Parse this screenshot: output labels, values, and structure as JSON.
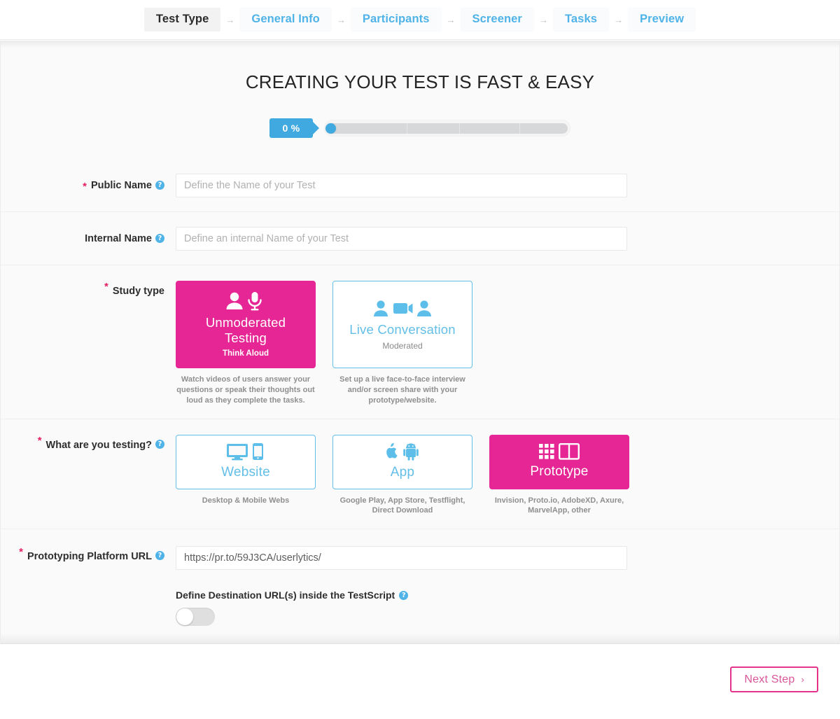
{
  "stepnav": {
    "separator": "→",
    "steps": [
      {
        "label": "Test Type",
        "state": "active"
      },
      {
        "label": "General Info",
        "state": "link"
      },
      {
        "label": "Participants",
        "state": "link"
      },
      {
        "label": "Screener",
        "state": "link"
      },
      {
        "label": "Tasks",
        "state": "link"
      },
      {
        "label": "Preview",
        "state": "link"
      }
    ]
  },
  "page": {
    "title": "CREATING YOUR TEST IS FAST & EASY"
  },
  "progress": {
    "percent_label": "0 %",
    "value": 0
  },
  "help_glyph": "?",
  "required_glyph": "*",
  "form": {
    "public_name": {
      "label": "Public Name",
      "required": true,
      "placeholder": "Define the Name of your Test",
      "value": ""
    },
    "internal_name": {
      "label": "Internal Name",
      "required": false,
      "placeholder": "Define an internal Name of your Test",
      "value": ""
    },
    "study_type": {
      "label": "Study type",
      "required": true,
      "options": [
        {
          "title": "Unmoderated Testing",
          "subtitle": "Think Aloud",
          "caption": "Watch videos of users answer your questions or speak their thoughts out loud as they complete the tasks.",
          "icon": "person-microphone-icon",
          "selected": true
        },
        {
          "title": "Live Conversation",
          "subtitle": "Moderated",
          "caption": "Set up a live face-to-face interview and/or screen share with your prototype/website.",
          "icon": "person-video-person-icon",
          "selected": false
        }
      ]
    },
    "testing_target": {
      "label": "What are you testing?",
      "required": true,
      "options": [
        {
          "title": "Website",
          "caption": "Desktop & Mobile Webs",
          "icon": "monitor-phone-icon",
          "selected": false
        },
        {
          "title": "App",
          "caption": "Google Play, App Store, Testflight, Direct Download",
          "icon": "apple-android-icon",
          "selected": false
        },
        {
          "title": "Prototype",
          "caption": "Invision, Proto.io, AdobeXD, Axure, MarvelApp, other",
          "icon": "grid-panel-icon",
          "selected": true
        }
      ]
    },
    "prototype_url": {
      "label": "Prototyping Platform URL",
      "required": true,
      "value": "https://pr.to/59J3CA/userlytics/",
      "placeholder": ""
    },
    "destination_url_toggle": {
      "label": "Define Destination URL(s) inside the TestScript",
      "state": "off"
    }
  },
  "footer": {
    "next_label": "Next Step",
    "next_chevron": "›"
  },
  "colors": {
    "accent_magenta": "#e62695",
    "accent_blue": "#4fb3e8",
    "card_border_blue": "#63bfe8",
    "required_red": "#e5205f",
    "button_border": "#e5338c"
  }
}
